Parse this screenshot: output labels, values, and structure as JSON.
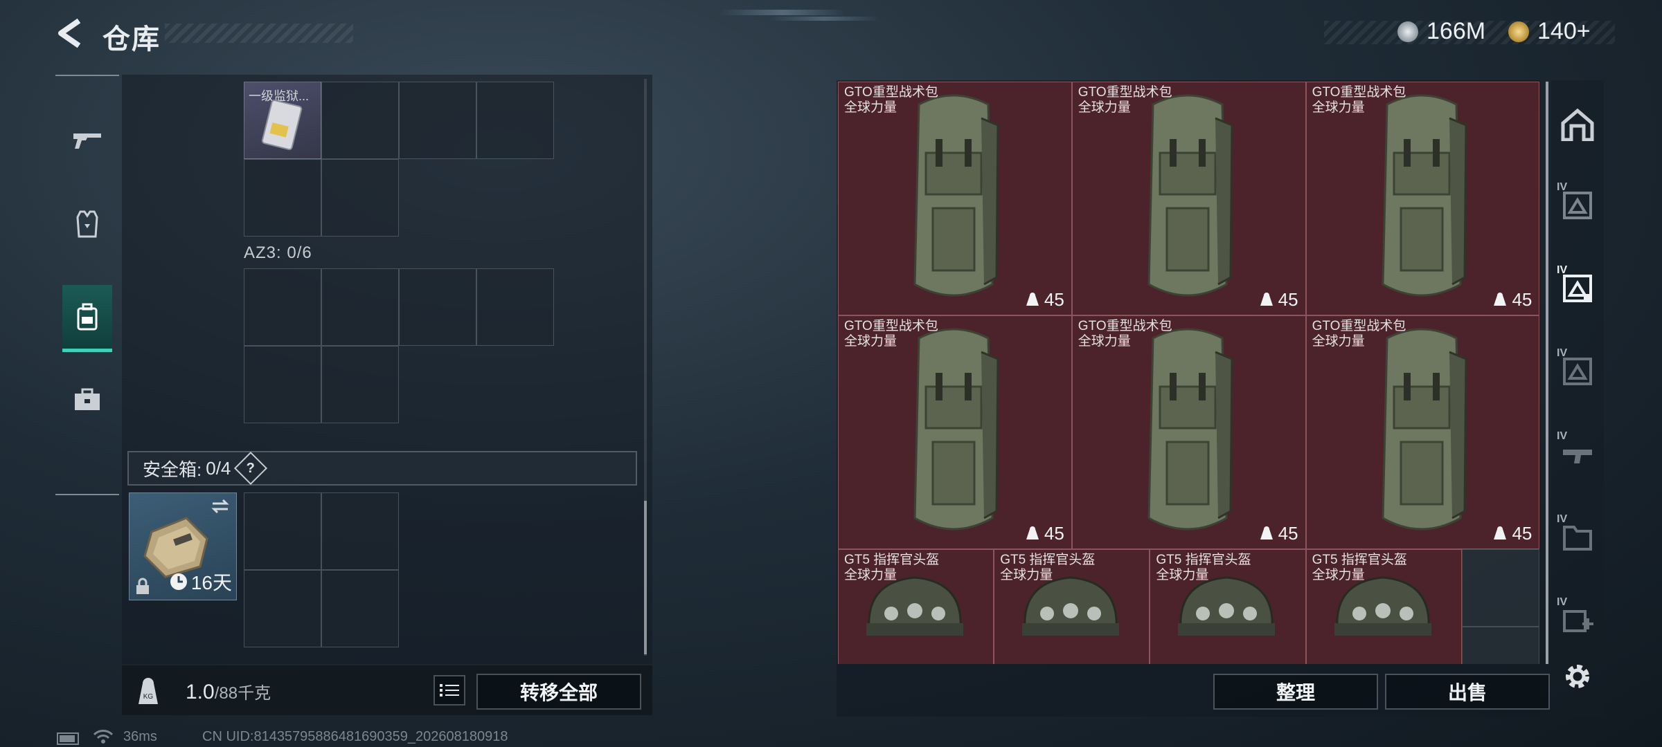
{
  "header": {
    "title": "仓库",
    "currency_a": "166M",
    "currency_b": "140+"
  },
  "left_nav": {
    "items": [
      "weapon-tab",
      "armor-tab",
      "backpack-tab",
      "toolbox-tab"
    ],
    "active": "backpack-tab"
  },
  "left_panel": {
    "top_item": {
      "name": "一级监狱..."
    },
    "container_label": "AZ3: 0/6",
    "safebox": {
      "label": "安全箱:",
      "count": "0/4",
      "help": "?",
      "days": "16天"
    },
    "weight": {
      "current": "1.0",
      "max": "/88千克"
    },
    "transfer_all": "转移全部"
  },
  "right_panel": {
    "items": [
      {
        "name": "GTO重型战术包",
        "sub": "全球力量",
        "capacity": "45"
      },
      {
        "name": "GTO重型战术包",
        "sub": "全球力量",
        "capacity": "45"
      },
      {
        "name": "GTO重型战术包",
        "sub": "全球力量",
        "capacity": "45"
      },
      {
        "name": "GTO重型战术包",
        "sub": "全球力量",
        "capacity": "45"
      },
      {
        "name": "GTO重型战术包",
        "sub": "全球力量",
        "capacity": "45"
      },
      {
        "name": "GTO重型战术包",
        "sub": "全球力量",
        "capacity": "45"
      },
      {
        "name": "GT5 指挥官头盔",
        "sub": "全球力量"
      },
      {
        "name": "GT5 指挥官头盔",
        "sub": "全球力量"
      },
      {
        "name": "GT5 指挥官头盔",
        "sub": "全球力量"
      },
      {
        "name": "GT5 指挥官头盔",
        "sub": "全球力量"
      }
    ],
    "sort_button": "整理",
    "sell_button": "出售"
  },
  "right_nav": {
    "tiers": [
      "",
      "IV",
      "IV",
      "IV",
      "IV",
      "IV",
      "IV"
    ]
  },
  "footer": {
    "ping": "36ms",
    "uid": "CN UID:81435795886481690359_202608180918"
  },
  "colors": {
    "accent": "#3fd0b8",
    "item_bg": "#4d232b"
  }
}
